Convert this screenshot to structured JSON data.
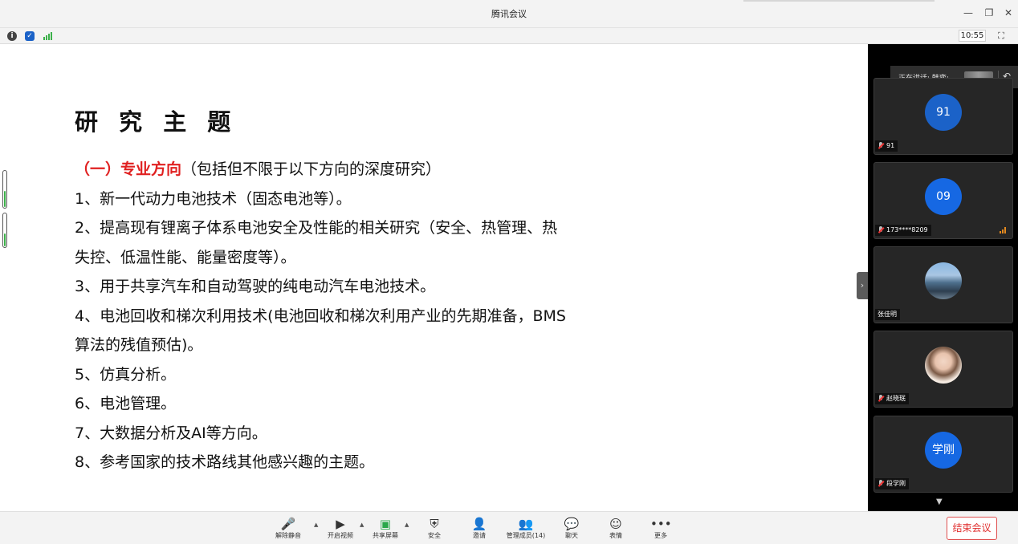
{
  "window": {
    "title": "腾讯会议"
  },
  "toolbar": {
    "time": "10:55"
  },
  "slide": {
    "title": "研 究 主 题",
    "section_heading": "（一）专业方向",
    "section_note": "（包括但不限于以下方向的深度研究）",
    "lines": [
      "1、新一代动力电池技术（固态电池等）。",
      "2、提高现有锂离子体系电池安全及性能的相关研究（安全、热管理、热",
      "失控、低温性能、能量密度等）。",
      "3、用于共享汽车和自动驾驶的纯电动汽车电池技术。",
      "4、电池回收和梯次利用技术(电池回收和梯次利用产业的先期准备，BMS",
      "算法的残值预估)。",
      "5、仿真分析。",
      "6、电池管理。",
      "7、大数据分析及AI等方向。",
      "8、参考国家的技术路线其他感兴趣的主题。"
    ]
  },
  "speaking": {
    "label": "正在讲话: 韩奕;"
  },
  "participants": [
    {
      "avatar_text": "91",
      "name": "91"
    },
    {
      "avatar_text": "09",
      "name": "173****8209"
    },
    {
      "avatar_text": "",
      "name": "张佳明"
    },
    {
      "avatar_text": "",
      "name": "赵晓珉"
    },
    {
      "avatar_text": "学刚",
      "name": "段学刚"
    }
  ],
  "bottom": {
    "unmute": "解除静音",
    "video": "开启视频",
    "share": "共享屏幕",
    "security": "安全",
    "invite": "邀请",
    "members": "管理成员(14)",
    "chat": "聊天",
    "emoji": "表情",
    "more": "更多",
    "end": "结束会议"
  },
  "colors": {
    "accent_red": "#e02020",
    "avatar_blue": "#1b62c8",
    "signal_green": "#3cb14a"
  }
}
